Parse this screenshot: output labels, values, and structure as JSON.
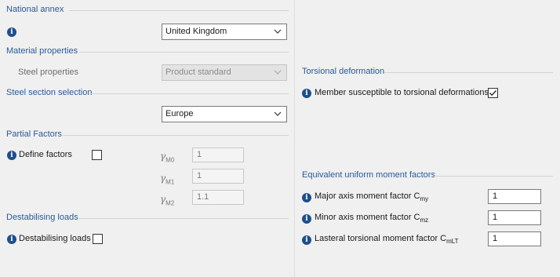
{
  "national_annex": {
    "title": "National annex",
    "select_value": "United Kingdom"
  },
  "material_properties": {
    "title": "Material properties",
    "label": "Steel properties",
    "select_value": "Product standard"
  },
  "steel_section_selection": {
    "title": "Steel section selection",
    "select_value": "Europe"
  },
  "partial_factors": {
    "title": "Partial Factors",
    "define_label": "Define factors",
    "define_checked": false,
    "gamma_symbol": "γ",
    "factors": [
      {
        "sub": "M0",
        "value": "1"
      },
      {
        "sub": "M1",
        "value": "1"
      },
      {
        "sub": "M2",
        "value": "1.1"
      }
    ]
  },
  "destabilising_loads": {
    "title": "Destabilising loads",
    "label": "Destabilising loads",
    "checked": false
  },
  "torsional_deformation": {
    "title": "Torsional deformation",
    "label": "Member susceptible to torsional deformations",
    "checked": true
  },
  "equivalent_moment_factors": {
    "title": "Equivalent uniform moment factors",
    "rows": [
      {
        "label": "Major axis moment factor C",
        "sub": "my",
        "value": "1"
      },
      {
        "label": "Minor axis moment factor C",
        "sub": "mz",
        "value": "1"
      },
      {
        "label": "Lasteral torsional moment factor C",
        "sub": "mLT",
        "value": "1"
      }
    ]
  },
  "colors": {
    "section_title": "#2a5a9a",
    "info_icon": "#1d4f8c",
    "background": "#f0f0f0"
  },
  "icons": {
    "info": "info-icon",
    "dropdown": "chevron-down-icon",
    "check": "checkmark-icon"
  }
}
